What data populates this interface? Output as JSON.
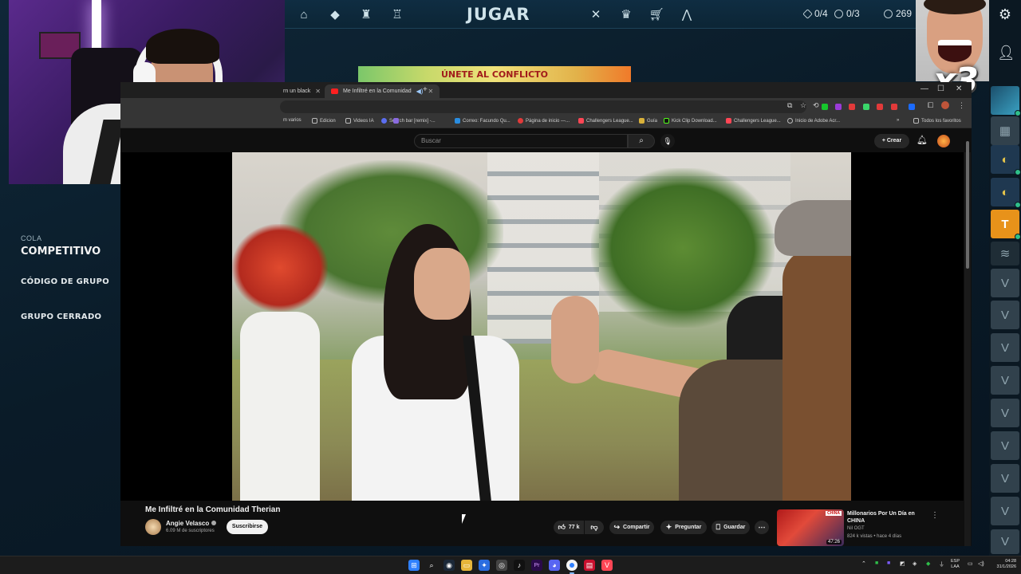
{
  "game": {
    "play_label": "JUGAR",
    "currency": [
      {
        "icon": "diamond-token-icon",
        "value": "0/4"
      },
      {
        "icon": "radianite-icon",
        "value": "0/3"
      },
      {
        "icon": "valorant-points-icon",
        "value": "269"
      }
    ],
    "nav_left": [
      "home-icon",
      "agents-icon",
      "battlepass-icon",
      "career-icon"
    ],
    "nav_right": [
      "collection-icon",
      "esports-icon",
      "store-icon",
      "rank-icon"
    ],
    "banner": "ÚNETE AL CONFLICTO",
    "queue_label": "COLA",
    "queue_name": "COMPETITIVO",
    "party_code": "CÓDIGO DE GRUPO",
    "party_closed": "GRUPO CERRADO",
    "combo": "x3",
    "colors": {
      "accent": "#0f2d42",
      "rail_gold": "#e8921a"
    }
  },
  "browser": {
    "tabs": [
      {
        "label": "rn un black",
        "active": false
      },
      {
        "label": "Me Infiltré en la Comunidad",
        "active": true
      }
    ],
    "bookmarks": [
      {
        "label": "m varios",
        "icon": "folder"
      },
      {
        "label": "Edicion",
        "icon": "folder"
      },
      {
        "label": "Videos IA",
        "icon": "folder"
      },
      {
        "label": "Search bar [remix] -...",
        "icon": "facebook"
      },
      {
        "label": "Correo: Facundo Qu...",
        "icon": "outlook"
      },
      {
        "label": "Página de inicio —...",
        "icon": "chrome"
      },
      {
        "label": "Challengers League...",
        "icon": "valorant"
      },
      {
        "label": "Guía",
        "icon": "folder"
      },
      {
        "label": "Kick Clip Download...",
        "icon": "kick"
      },
      {
        "label": "Challengers League...",
        "icon": "valorant"
      },
      {
        "label": "Inicio de Adobe Acr...",
        "icon": "adobe"
      },
      {
        "label": "Todos los favoritos",
        "icon": "folder"
      }
    ]
  },
  "youtube": {
    "search_placeholder": "Buscar",
    "create_label": "Crear",
    "video_title": "Me Infiltré en la Comunidad Therian",
    "channel_name": "Angie Velasco",
    "channel_subs": "6.09 M de suscriptores",
    "subscribe_label": "Suscribirse",
    "likes": "77 k",
    "share_label": "Compartir",
    "ask_label": "Preguntar",
    "save_label": "Guardar",
    "recommended": {
      "title": "Millonarios Por Un Día en CHINA",
      "channel": "Nil OGT",
      "meta": "824 k vistas • hace 4 días",
      "duration": "47:26",
      "tag": "CHINA"
    }
  },
  "taskbar": {
    "lang_line1": "ESP",
    "lang_line2": "LAA",
    "time": "04:28",
    "date": "31/1/2026"
  }
}
